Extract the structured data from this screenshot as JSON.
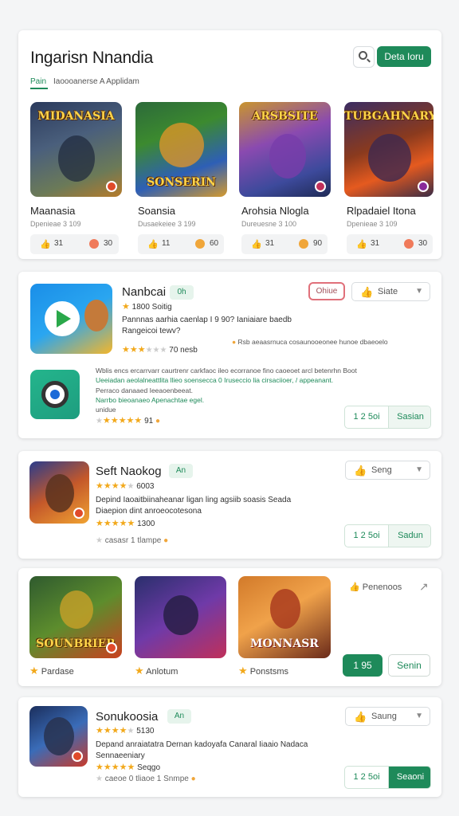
{
  "header": {
    "title": "Ingarisn Nnandia",
    "search_icon": "search-icon",
    "cta_label": "Deta Ioru",
    "subtab_active": "Pain",
    "subtab_text": "Iaoooanerse A Applidam"
  },
  "featured": [
    {
      "art": "MIDANASIA",
      "name": "Maanasia",
      "sub": "Dpenieae 3 109",
      "likes": "31",
      "rating": "30"
    },
    {
      "art": "SONSERIN",
      "name": "Soansia",
      "sub": "Dusaekeiee 3 199",
      "likes": "11",
      "rating": "60"
    },
    {
      "art": "ARSBSITE",
      "name": "Arohsia Nlogla",
      "sub": "Dureuesne 3 100",
      "likes": "31",
      "rating": "90"
    },
    {
      "art": "TUBGAHNARY",
      "name": "Rlpadaiel Itona",
      "sub": "Dpenieae 3 109",
      "likes": "31",
      "rating": "30"
    }
  ],
  "card1": {
    "name": "Nanbcai",
    "tag": "0h",
    "rating_line": "1800 Soitig",
    "desc1": "Pannnas aarhia caenlap I 9 90? Ianiaiare baedb",
    "desc2": "Rangeicoi tewv?",
    "rating_count": "70 nesb",
    "side_note": "Rsb aeaasrnuca cosaunooeonee hunoe dbaeoelo",
    "chip_label": "Ohiue",
    "select_label": "Siate",
    "row2_line1": "Wblis encs ercarrvarr caurtrenr carkfaoc ileo ecorranoe fino caoeoet arcl betenrhn Boot",
    "row2_line2": "Ueeiadan aeolalneattlita llieo soensecca 0 Iruseccio lia cirsaciioer, / appeanant.",
    "row2_line3": "Perraco danaaed Ieeaoenbeeat.",
    "row2_line4": "Narrbo bieoanaeo Apenachtae egel.",
    "row2_line5": "unidue",
    "row2_rating": "91",
    "btn_left": "1 2 5oi",
    "btn_right": "Sasian"
  },
  "card2": {
    "name": "Seft Naokog",
    "tag": "An",
    "rating_count": "6003",
    "desc": "Depind Iaoaitbiinaheanar ligan ling agsiib soasis Seada",
    "desc2": "Diaepion dint anroeocotesona",
    "rating2": "1300",
    "meta": "casasr 1 tlampe",
    "select_label": "Seng",
    "btn_left": "1 2 5oi",
    "btn_right": "Sadun"
  },
  "card3": {
    "items": [
      {
        "art": "SOUNBRIER",
        "label": "Pardase"
      },
      {
        "art": "",
        "label": "Anlotum"
      },
      {
        "art": "MONNASR",
        "label": "Ponstsms"
      }
    ],
    "side_label": "Penenoos",
    "btn_left": "1 95",
    "btn_right": "Senin"
  },
  "card4": {
    "name": "Sonukoosia",
    "tag": "An",
    "rating_count": "5130",
    "desc": "Depand anraiatatra Dernan kadoyafa Canaral Iiaaio Nadaca",
    "desc2": "Sennaeeniary",
    "rating2": "Seqgo",
    "meta": "caeoe 0 tliaoe 1 Snmpe",
    "select_label": "Saung",
    "btn_left": "1 2 5oi",
    "btn_right": "Seaoni"
  },
  "colors": {
    "accent": "#1e8a5a",
    "star": "#f2a91c",
    "chip_border": "#e0707a"
  }
}
